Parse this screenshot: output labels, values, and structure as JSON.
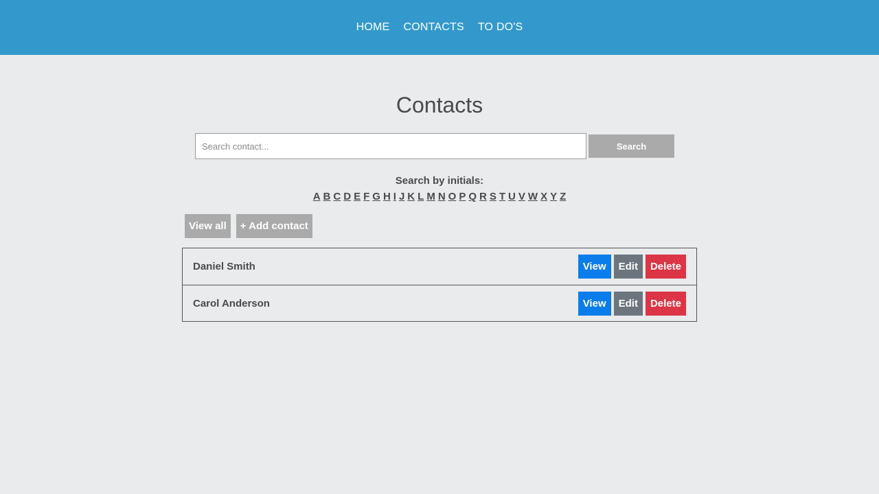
{
  "nav": {
    "items": [
      "HOME",
      "CONTACTS",
      "TO DO'S"
    ]
  },
  "page": {
    "title": "Contacts"
  },
  "search": {
    "placeholder": "Search contact...",
    "value": "",
    "button_label": "Search"
  },
  "initials": {
    "label": "Search by initials:",
    "letters": [
      "A",
      "B",
      "C",
      "D",
      "E",
      "F",
      "G",
      "H",
      "I",
      "J",
      "K",
      "L",
      "M",
      "N",
      "O",
      "P",
      "Q",
      "R",
      "S",
      "T",
      "U",
      "V",
      "W",
      "X",
      "Y",
      "Z"
    ]
  },
  "actions": {
    "view_all_label": "View all",
    "add_contact_label": "+ Add contact"
  },
  "contacts": [
    {
      "name": "Daniel Smith",
      "view": "View",
      "edit": "Edit",
      "delete": "Delete"
    },
    {
      "name": "Carol Anderson",
      "view": "View",
      "edit": "Edit",
      "delete": "Delete"
    }
  ],
  "colors": {
    "header": "#3399cc",
    "background": "#e9ebed",
    "view": "#0b7dea",
    "edit": "#6c757d",
    "delete": "#dc3545",
    "gray_button": "#aaaaaa"
  }
}
